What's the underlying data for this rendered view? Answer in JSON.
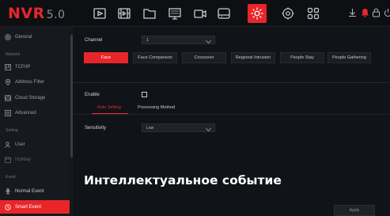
{
  "app": {
    "logo_text": "NVR",
    "logo_version": "5.0"
  },
  "topnav": {
    "icons": [
      "playback-icon",
      "film-icon",
      "folder-icon",
      "monitor-icon",
      "camera-icon",
      "storage-icon",
      "settings-icon",
      "network-icon",
      "grid-icon"
    ],
    "active_icon": "settings-icon",
    "right_icons": [
      "download-icon",
      "alarm-icon",
      "lock-icon",
      "power-icon"
    ]
  },
  "sidebar": {
    "general": "General",
    "network_section": "Network",
    "tcpip": "TCP/IP",
    "address_filter": "Address Filter",
    "cloud_storage": "Cloud Storage",
    "advanced": "Advanced",
    "setting_section": "Setting",
    "user": "User",
    "holiday": "Holiday",
    "event_section": "Event",
    "normal_event": "Normal Event",
    "smart_event": "Smart Event"
  },
  "main": {
    "channel_label": "Channel",
    "channel_value": "1",
    "tabs": [
      "Face",
      "Face Comparison",
      "Crossover",
      "Regional Intrusion",
      "People Stay",
      "People Gathering"
    ],
    "active_tab": "Face",
    "enable_label": "Enable",
    "enable_checked": false,
    "subtabs": [
      "Rule Setting",
      "Processing Method"
    ],
    "active_subtab": "Rule Setting",
    "sensitivity_label": "Sensitivity",
    "sensitivity_value": "Low",
    "apply_label": "Apply"
  },
  "overlay_caption": "Интеллектуальное событие",
  "colors": {
    "accent": "#e8262a",
    "background": "#101317",
    "sidebar": "#16191d"
  }
}
